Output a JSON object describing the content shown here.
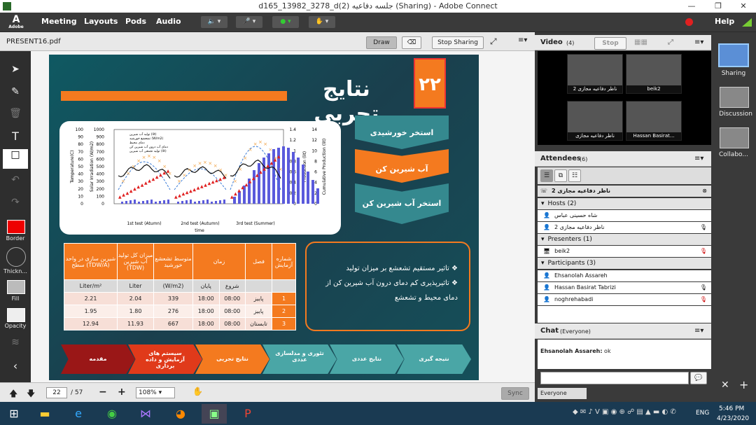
{
  "window": {
    "title": "d165_13982_3278_d(2) جلسه دفاعیه (Sharing) - Adobe Connect",
    "minimize": "—",
    "restore": "❐",
    "close": "✕"
  },
  "menu": {
    "logo": "Adobe",
    "items": [
      "Meeting",
      "Layouts",
      "Pods",
      "Audio"
    ],
    "help": "Help"
  },
  "share_pod": {
    "filename": "PRESENT16.pdf",
    "draw": "Draw",
    "stop_sharing": "Stop Sharing"
  },
  "toolbar": {
    "border": "Border",
    "thickness": "Thickn...",
    "fill": "Fill",
    "opacity": "Opacity"
  },
  "slide": {
    "number": "۲۲",
    "title": "نتایج تجربی",
    "flow": [
      "استخر خورشیدی",
      "آب شیرین کن",
      "استخر آب شیرین کن"
    ],
    "bullets": [
      "تاثیر مستقیم تشعشع بر میزان تولید",
      "تاثیرپذیری کم دمای درون آب شیرین کن از دمای محیط و تشعشع"
    ],
    "nav": [
      "مقدمه",
      "سیستم های آزمایش و داده برداری",
      "نتایج تجربی",
      "تئوری و مدلسازی عددی",
      "نتایج عددی",
      "نتیجه گیری"
    ],
    "table": {
      "headers": [
        "شماره آزمایش",
        "فصل",
        "زمان",
        "متوسط تشعشع خورشید",
        "میزان کل تولید آب شیرین (TDW)",
        "شیرین سازی در واحد سطح (TDW/A)"
      ],
      "subheaders": [
        "شروع",
        "پایان",
        "(W/m2)",
        "Liter",
        "Liter/m²"
      ],
      "rows": [
        {
          "num": "1",
          "season": "پاییز",
          "start": "08:00",
          "end": "18:00",
          "rad": "339",
          "tdw": "2.04",
          "area": "2.21"
        },
        {
          "num": "2",
          "season": "پاییز",
          "start": "08:00",
          "end": "18:00",
          "rad": "276",
          "tdw": "1.80",
          "area": "1.95"
        },
        {
          "num": "3",
          "season": "تابستان",
          "start": "08:00",
          "end": "18:00",
          "rad": "667",
          "tdw": "11.93",
          "area": "12.94"
        }
      ]
    },
    "chart": {
      "xlabel": "time",
      "tests": [
        "1st test (Atumn)",
        "2nd test (Autumn)",
        "3rd test (Summer)"
      ],
      "yleft1": "Temperature(C)",
      "yleft2": "Solar Irradiation (W/m2)",
      "yright1": "Production (lit)",
      "yright2": "Cumulative Production (lit)",
      "ticks_temp": [
        "100",
        "90",
        "80",
        "70",
        "60",
        "50",
        "40",
        "30",
        "20",
        "10",
        "0"
      ],
      "ticks_solar": [
        "1000",
        "900",
        "800",
        "700",
        "600",
        "500",
        "400",
        "300",
        "200",
        "100",
        "0"
      ],
      "ticks_prod": [
        "1.4",
        "1.2",
        "1",
        "0.8",
        "0.6",
        "0.4",
        "0.2",
        "0"
      ],
      "ticks_cum": [
        "14",
        "12",
        "10",
        "8",
        "6",
        "4",
        "2",
        "0"
      ],
      "legend": [
        "تولید آب شیرین (lit)",
        "تشعشع خورشید (W/m2)",
        "دمای محیط",
        "دمای آب درون آب شیرین کن",
        "تولید تجمعی آب شیرین (lit)"
      ]
    }
  },
  "bottom": {
    "page": "22",
    "total": "/ 57",
    "zoom": "108%",
    "sync": "Sync"
  },
  "video": {
    "title": "Video",
    "count": "(4)",
    "stop": "Stop",
    "names": [
      "ناظر دفاعیه مجازی 2",
      "beik2",
      "ناظر دفاعیه مجازی",
      "Hassan Basirat..."
    ]
  },
  "attendees": {
    "title": "Attendees",
    "count": "(6)",
    "current": "ناظر دفاعیه مجازی 2",
    "hosts_label": "Hosts (2)",
    "hosts": [
      "شاه حسینی عباس",
      "ناظر دفاعیه مجازی 2"
    ],
    "presenters_label": "Presenters (1)",
    "presenters": [
      "beik2"
    ],
    "participants_label": "Participants (3)",
    "participants": [
      "Ehsanolah Assareh",
      "Hassan Basirat Tabrizi",
      "noghrehabadi"
    ]
  },
  "chat": {
    "title": "Chat",
    "scope": "(Everyone)",
    "msg_user": "Ehsanolah Assareh:",
    "msg_text": " ok",
    "to": "Everyone"
  },
  "farright": {
    "items": [
      "Sharing",
      "Discussion",
      "Collabo..."
    ]
  },
  "taskbar": {
    "lang": "ENG",
    "time": "5:46 PM",
    "date": "4/23/2020"
  }
}
